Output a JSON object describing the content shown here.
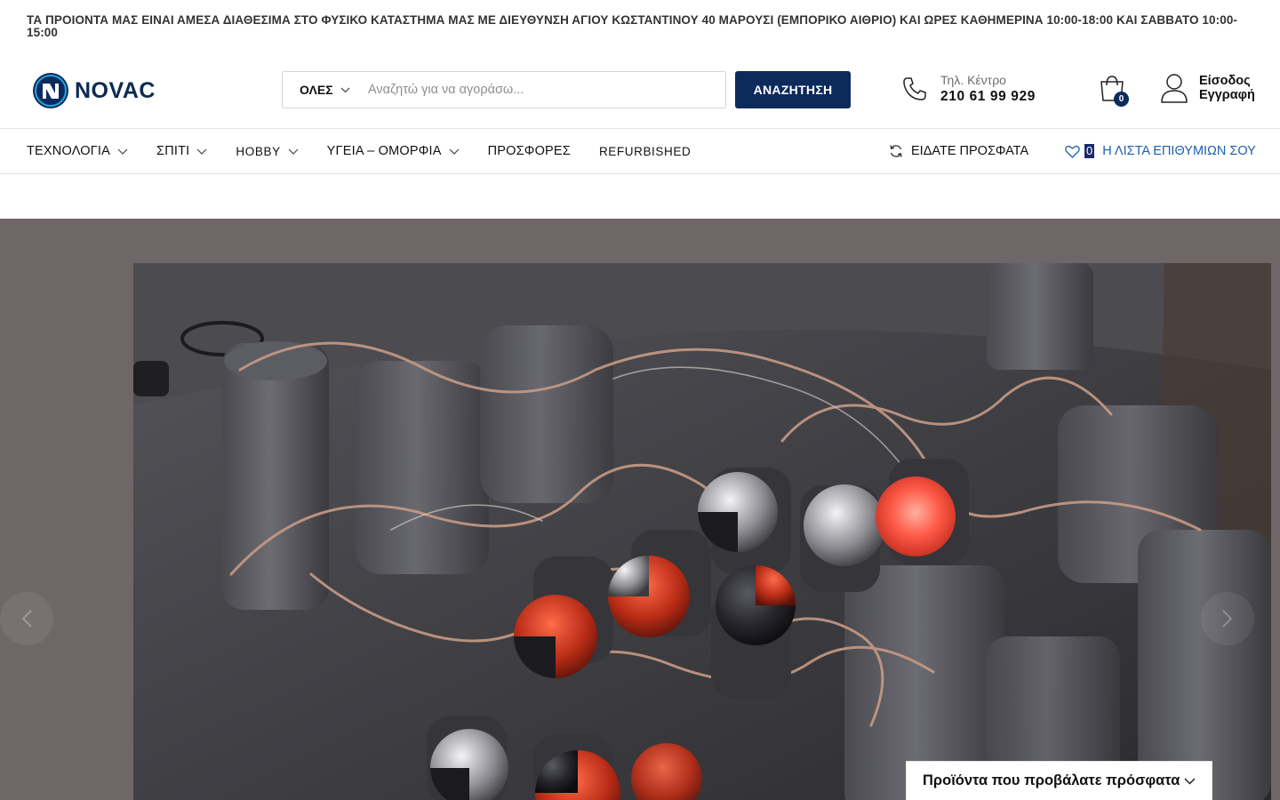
{
  "announcement": "ΤΑ ΠΡΟΙΟΝΤΑ ΜΑΣ ΕΙΝΑΙ ΑΜΕΣΑ ΔΙΑΘΕΣΙΜΑ ΣΤΟ ΦΥΣΙΚΟ ΚΑΤΑΣΤΗΜΑ ΜΑΣ ΜΕ ΔΙΕΥΘΥΝΣΗ ΑΓΙΟΥ ΚΩΣΤΑΝΤΙΝΟΥ 40 ΜΑΡΟΥΣΙ (ΕΜΠΟΡΙΚΟ ΑΙΘΡΙΟ) ΚΑΙ ΩΡΕΣ ΚΑΘΗΜΕΡΙΝΑ 10:00-18:00 ΚΑΙ ΣΑΒΒΑΤΟ 10:00-15:00",
  "brand": {
    "name": "NOVAC",
    "color": "#0d2a5c"
  },
  "search": {
    "category": "ΟΛΕΣ",
    "placeholder": "Αναζητώ για να αγοράσω...",
    "value": "",
    "button": "ΑΝΑΖΗΤΗΣΗ"
  },
  "contact": {
    "label": "Τηλ. Κέντρο",
    "phone": "210 61 99 929"
  },
  "cart": {
    "count": "0"
  },
  "account": {
    "login": "Είσοδος",
    "register": "Εγγραφή"
  },
  "nav": {
    "items": [
      {
        "label": "ΤΕΧΝΟΛΟΓΙΑ"
      },
      {
        "label": "ΣΠΙΤΙ"
      },
      {
        "label": "HOBBY"
      },
      {
        "label": "ΥΓΕΙΑ – ΟΜΟΡΦΙΑ"
      },
      {
        "label": "ΠΡΟΣΦΟΡΕΣ"
      },
      {
        "label": "REFURBISHED"
      }
    ],
    "recently_viewed": "ΕΙΔΑΤΕ ΠΡΟΣΦΑΤΑ",
    "wishlist_count": "0",
    "wishlist_label": "Η ΛΙΣΤΑ ΕΠΙΘΥΜΙΩΝ ΣΟΥ"
  },
  "recent_panel": {
    "title": "Προϊόντα που προβάλατε πρόσφατα"
  },
  "icons": {
    "search_chevron": "chevron-down-icon",
    "phone": "phone-icon",
    "cart": "shopping-bag-icon",
    "account": "user-icon",
    "refresh": "refresh-icon",
    "wishlist": "heart-icon",
    "slider_prev": "chevron-left-icon",
    "slider_next": "chevron-right-icon"
  },
  "colors": {
    "accent": "#0d2a5c",
    "link": "#1d5fae",
    "hero_bg": "#6f6667"
  }
}
